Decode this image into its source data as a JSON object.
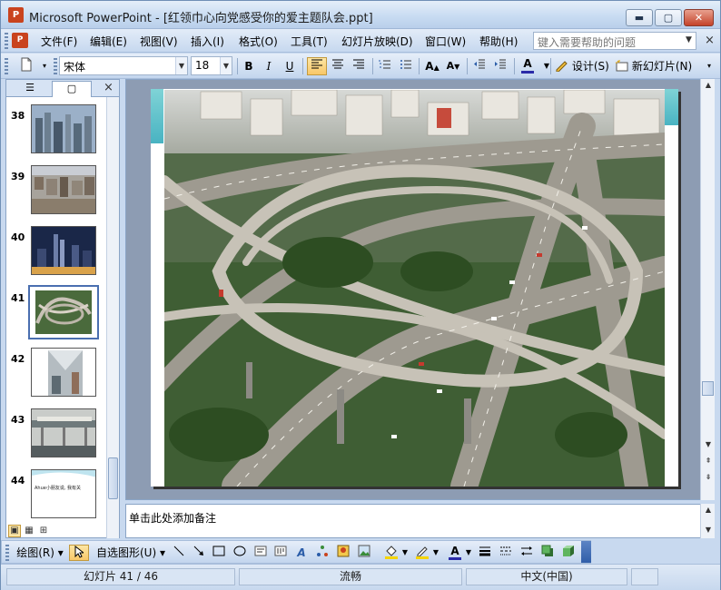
{
  "window": {
    "app_icon": "P",
    "title": "Microsoft PowerPoint - [红领巾心向党感受你的爱主题队会.ppt]",
    "minimize_glyph": "▬",
    "maximize_glyph": "▢",
    "close_glyph": "✕"
  },
  "menubar": {
    "doc_icon": "P",
    "items": [
      "文件(F)",
      "编辑(E)",
      "视图(V)",
      "插入(I)",
      "格式(O)",
      "工具(T)",
      "幻灯片放映(D)",
      "窗口(W)",
      "帮助(H)"
    ],
    "help_placeholder": "键入需要帮助的问题",
    "close_glyph": "×"
  },
  "toolbar": {
    "font_name": "宋体",
    "font_size": "18",
    "bold": "B",
    "italic": "I",
    "underline": "U",
    "design_label": "设计(S)",
    "new_slide_label": "新幻灯片(N)",
    "font_color": "#2a2aa8",
    "design_icon": "palette-icon",
    "new_slide_icon": "new-slide-icon"
  },
  "left_panel": {
    "tab_outline_glyph": "☰",
    "tab_slides_glyph": "▢",
    "close_glyph": "×",
    "slides": [
      {
        "number": "38",
        "image": "city-skyline-day-icon"
      },
      {
        "number": "39",
        "image": "city-aerial-icon"
      },
      {
        "number": "40",
        "image": "city-night-icon"
      },
      {
        "number": "41",
        "image": "interchange-icon",
        "selected": true
      },
      {
        "number": "42",
        "image": "subway-station-icon"
      },
      {
        "number": "43",
        "image": "train-bridge-icon"
      },
      {
        "number": "44",
        "image": "text-slide-icon",
        "text": "Ahue小朋友说, 我有关"
      }
    ]
  },
  "view_buttons": [
    "normal-view-icon",
    "slide-sorter-icon",
    "slideshow-icon"
  ],
  "slide": {
    "image": "highway-interchange-photo"
  },
  "notes": {
    "placeholder": "单击此处添加备注"
  },
  "drawbar": {
    "draw_label": "绘图(R)",
    "autoshape_label": "自选图形(U)",
    "fill_color": "#f5d400",
    "line_color": "#f5d400",
    "font_color": "#2a2aa8"
  },
  "statusbar": {
    "slide_info": "幻灯片 41 / 46",
    "design_name": "流畅",
    "language": "中文(中国)"
  }
}
